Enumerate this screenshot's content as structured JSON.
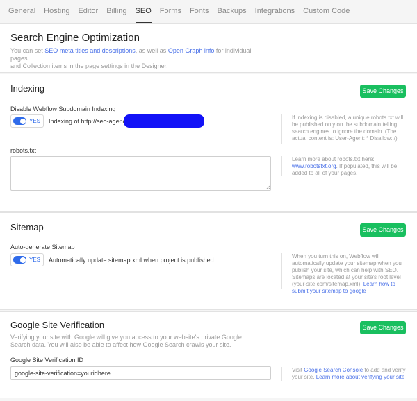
{
  "tabs": [
    "General",
    "Hosting",
    "Editor",
    "Billing",
    "SEO",
    "Forms",
    "Fonts",
    "Backups",
    "Integrations",
    "Custom Code"
  ],
  "active_tab": "SEO",
  "seo": {
    "title": "Search Engine Optimization",
    "desc_pre": "You can set ",
    "desc_link1": "SEO meta titles and descriptions",
    "desc_mid": ", as well as ",
    "desc_link2": "Open Graph info",
    "desc_post": " for individual pages",
    "desc_line2": "and Collection items in the page settings in the Designer."
  },
  "indexing": {
    "title": "Indexing",
    "save": "Save Changes",
    "disable_label": "Disable Webflow Subdomain Indexing",
    "toggle": "YES",
    "toggle_text": "Indexing of http://seo-agency-",
    "side": "If indexing is disabled, a unique robots.txt will be published only on the subdomain telling search engines to ignore the domain. (The actual content is: User-Agent: * Disallow: /)",
    "robots_label": "robots.txt",
    "robots_side_pre": "Learn more about robots.txt here:",
    "robots_side_link": "www.robotstxt.org",
    "robots_side_post": ". If populated, this will be added to all of your pages."
  },
  "sitemap": {
    "title": "Sitemap",
    "save": "Save Changes",
    "label": "Auto-generate Sitemap",
    "toggle": "YES",
    "toggle_text": "Automatically update sitemap.xml when project is published",
    "side_pre": "When you turn this on, Webflow will automatically update your sitemap when you publish your site, which can help with SEO. Sitemaps are located at your site's root level (your-site.com/sitemap.xml). ",
    "side_link": "Learn how to submit your sitemap to google"
  },
  "verification": {
    "title": "Google Site Verification",
    "save": "Save Changes",
    "desc": "Verifying your site with Google will give you access to your website's private Google Search data. You will also be able to affect how Google Search crawls your site.",
    "label": "Google Site Verification ID",
    "value": "google-site-verification=youridhere",
    "side_pre": "Visit ",
    "side_link1": "Google Search Console",
    "side_mid": " to add and verify your site. ",
    "side_link2": "Learn more about verifying your site"
  },
  "colors": {
    "accent": "#19bf5f",
    "link": "#4a71e8",
    "toggle": "#2f6bea",
    "redaction": "#1212f7"
  },
  "icons": {
    "resize": "resize-grip-icon"
  }
}
